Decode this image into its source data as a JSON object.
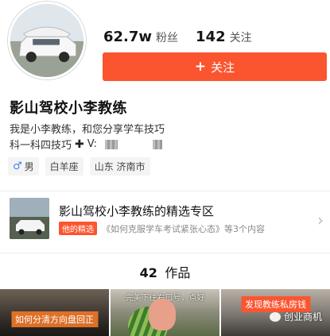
{
  "profile": {
    "followers_count": "62.7w",
    "followers_label": "粉丝",
    "following_count": "142",
    "following_label": "关注",
    "follow_button_label": "关注",
    "name": "影山驾校小李教练",
    "bio_line1": "我是小李教练，和您分享学车技巧",
    "bio_line2_prefix": "科一科四技巧",
    "bio_line2_contact": "V:",
    "tags": {
      "gender": "男",
      "zodiac": "白羊座",
      "location": "山东 济南市"
    }
  },
  "featured": {
    "title": "影山驾校小李教练的精选专区",
    "badge": "他的精选",
    "summary": "《如何克服学车考试紧张心态》等3个内容"
  },
  "works": {
    "count": "42",
    "label": "作品"
  },
  "grid": [
    {
      "caption": "如何分清方向盘回正"
    },
    {
      "caption": "完美下往右口号，点好"
    },
    {
      "caption": "发现教练私房钱"
    }
  ],
  "watermark": "创业商机",
  "colors": {
    "accent": "#fb5530",
    "male": "#3b82f6"
  },
  "icons": [
    "plus-icon",
    "cross-icon",
    "male-icon",
    "chevron-right-icon",
    "wechat-icon"
  ]
}
